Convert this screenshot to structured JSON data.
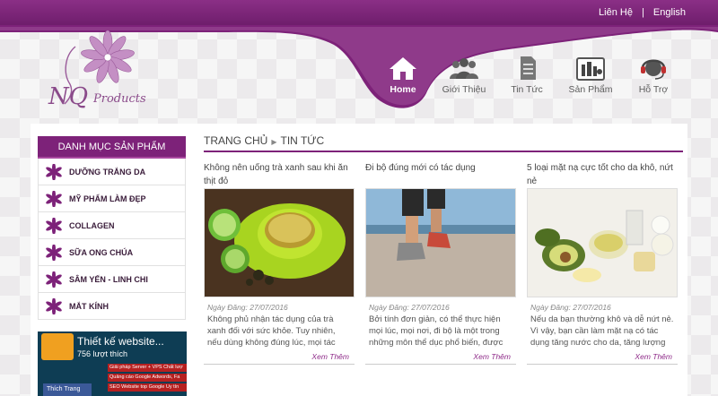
{
  "header": {
    "links": [
      "Liên Hệ",
      "English"
    ]
  },
  "logo": {
    "text": "NQ Products"
  },
  "nav": [
    {
      "label": "Home",
      "icon": "home-icon",
      "active": true
    },
    {
      "label": "Giới Thiệu",
      "icon": "users-icon",
      "active": false
    },
    {
      "label": "Tin Tức",
      "icon": "document-icon",
      "active": false
    },
    {
      "label": "Sản Phẩm",
      "icon": "cosmetics-icon",
      "active": false
    },
    {
      "label": "Hỗ Trợ",
      "icon": "headset-icon",
      "active": false
    }
  ],
  "sidebar": {
    "title": "DANH MỤC SẢN PHẨM",
    "items": [
      {
        "label": "DƯỠNG TRẮNG DA"
      },
      {
        "label": "MỸ PHẨM LÀM ĐẸP"
      },
      {
        "label": "COLLAGEN"
      },
      {
        "label": "SỮA ONG CHÚA"
      },
      {
        "label": "SÂM YẾN - LINH CHI"
      },
      {
        "label": "MẮT KÍNH"
      }
    ]
  },
  "banner": {
    "title": "Thiết kế website...",
    "likes": "756 lượt thích",
    "rows": [
      "Giải pháp Server + VPS Chất lượ",
      "Quảng cáo Google Adwords, Fa",
      "SEO Website top Google Uy tín"
    ],
    "like_button": "Thích Trang"
  },
  "breadcrumb": {
    "home": "TRANG CHỦ",
    "current": "TIN TỨC"
  },
  "articles": [
    {
      "title": "Không nên uống trà xanh sau khi ăn thịt đỏ",
      "date": "Ngày Đăng: 27/07/2016",
      "desc": "Không phủ nhận tác dụng của trà xanh đối với sức khỏe. Tuy nhiên, nếu dùng không đúng lúc, mọi tác dụng của trà",
      "more": "Xem Thêm"
    },
    {
      "title": "Đi bộ đúng mới có tác dụng",
      "date": "Ngày Đăng: 27/07/2016",
      "desc": "Bởi tính đơn giản, có thể thực hiện mọi lúc, mọi nơi, đi bộ là một trong những môn thể dục phổ biến, được ưa chuộng",
      "more": "Xem Thêm"
    },
    {
      "title": "5 loại mặt nạ cực tốt cho da khô, nứt nẻ",
      "date": "Ngày Đăng: 27/07/2016",
      "desc": "Nếu da bạn thường khô và dễ nứt nẻ. Vì vậy, bạn cần làm mặt nạ có tác dụng tăng nước cho da, tăng lượng dầu bảo",
      "more": "Xem Thêm"
    }
  ],
  "colors": {
    "brand": "#7d2279",
    "accent": "#8e2a88"
  }
}
